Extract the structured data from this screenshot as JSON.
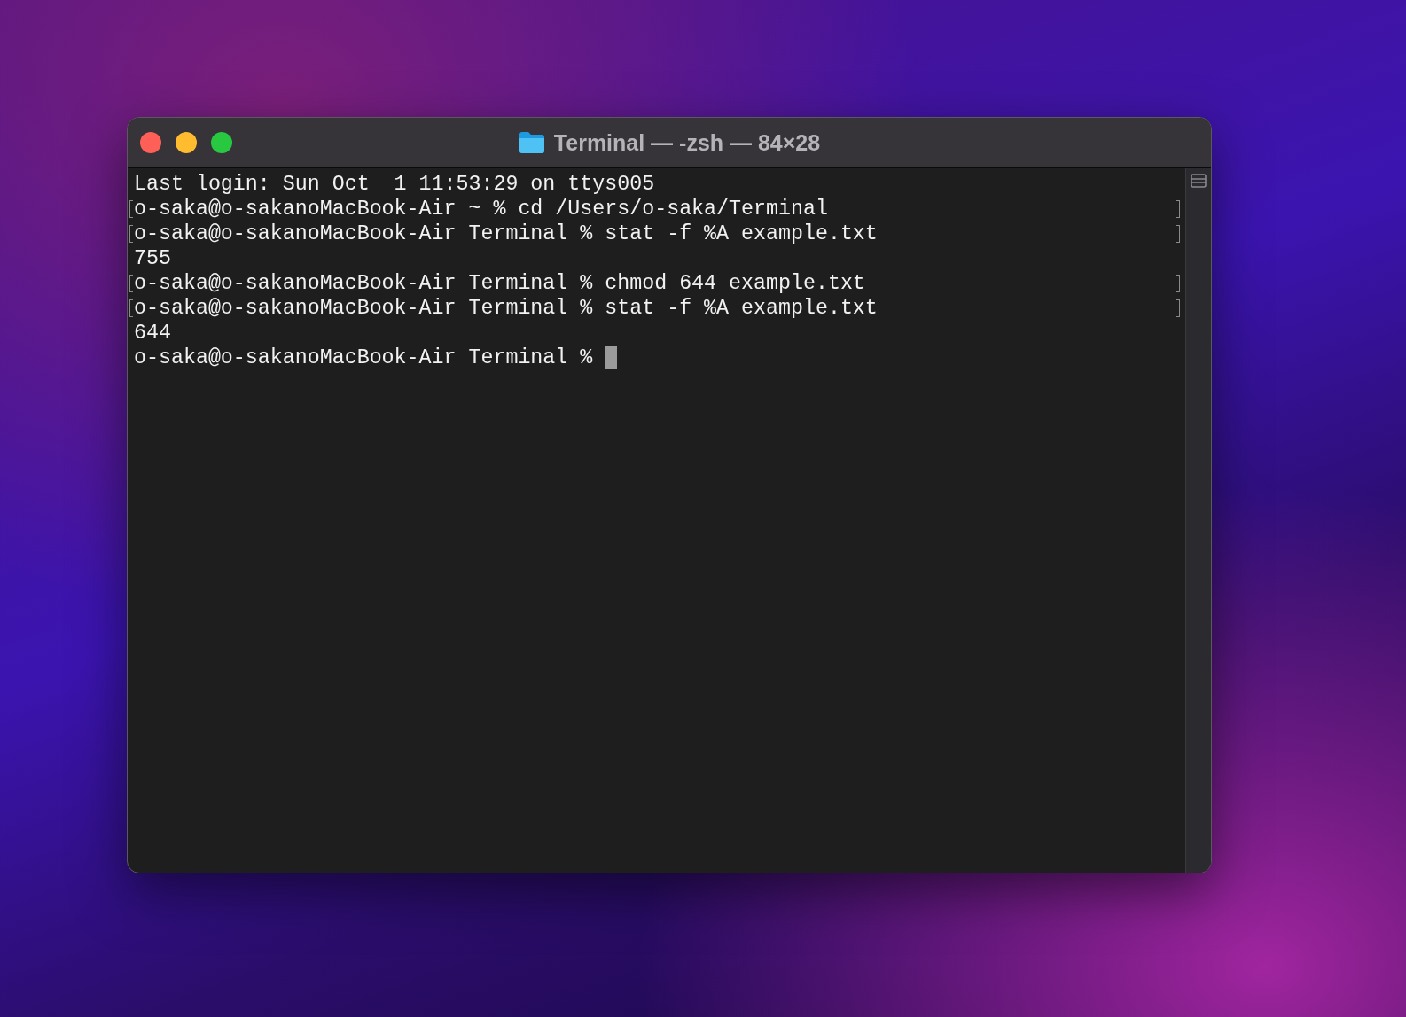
{
  "window": {
    "title": "Terminal — -zsh — 84×28"
  },
  "lines": [
    {
      "text": "Last login: Sun Oct  1 11:53:29 on ttys005",
      "marked": false
    },
    {
      "text": "o-saka@o-sakanoMacBook-Air ~ % cd /Users/o-saka/Terminal",
      "marked": true
    },
    {
      "text": "o-saka@o-sakanoMacBook-Air Terminal % stat -f %A example.txt",
      "marked": true
    },
    {
      "text": "755",
      "marked": false
    },
    {
      "text": "o-saka@o-sakanoMacBook-Air Terminal % chmod 644 example.txt",
      "marked": true
    },
    {
      "text": "o-saka@o-sakanoMacBook-Air Terminal % stat -f %A example.txt",
      "marked": true
    },
    {
      "text": "644",
      "marked": false
    }
  ],
  "prompt": {
    "text": "o-saka@o-sakanoMacBook-Air Terminal %"
  }
}
